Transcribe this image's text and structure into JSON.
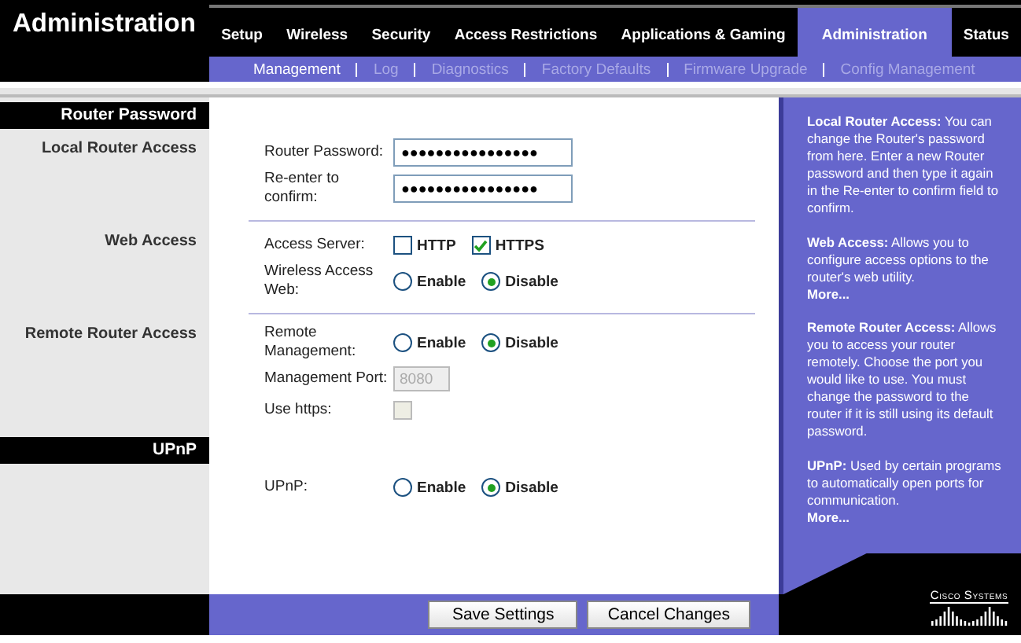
{
  "header": {
    "title": "Administration"
  },
  "tabs": [
    {
      "label": "Setup",
      "selected": false
    },
    {
      "label": "Wireless",
      "selected": false
    },
    {
      "label": "Security",
      "selected": false
    },
    {
      "label": "Access Restrictions",
      "selected": false
    },
    {
      "label": "Applications & Gaming",
      "selected": false
    },
    {
      "label": "Administration",
      "selected": true
    },
    {
      "label": "Status",
      "selected": false
    }
  ],
  "subtabs": [
    {
      "label": "Management",
      "selected": true
    },
    {
      "label": "Log",
      "selected": false
    },
    {
      "label": "Diagnostics",
      "selected": false
    },
    {
      "label": "Factory Defaults",
      "selected": false
    },
    {
      "label": "Firmware Upgrade",
      "selected": false
    },
    {
      "label": "Config Management",
      "selected": false
    }
  ],
  "rows": [
    {
      "kind": "header",
      "label": "Router Password"
    },
    {
      "kind": "section",
      "label": "Local Router Access",
      "fields": [
        {
          "kind": "password",
          "label": "Router Password:",
          "value": "●●●●●●●●●●●●●●●●"
        },
        {
          "kind": "password",
          "label": "Re-enter to confirm:",
          "value": "●●●●●●●●●●●●●●●●"
        }
      ]
    },
    {
      "kind": "section",
      "label": "Web Access",
      "fields": [
        {
          "kind": "checkboxes",
          "label": "Access Server:",
          "options": [
            {
              "label": "HTTP",
              "checked": false
            },
            {
              "label": "HTTPS",
              "checked": true
            }
          ]
        },
        {
          "kind": "radios",
          "label": "Wireless Access Web:",
          "options": [
            {
              "label": "Enable",
              "selected": false
            },
            {
              "label": "Disable",
              "selected": true
            }
          ]
        }
      ]
    },
    {
      "kind": "section",
      "label": "Remote Router Access",
      "fields": [
        {
          "kind": "radios",
          "label": "Remote Management:",
          "options": [
            {
              "label": "Enable",
              "selected": false
            },
            {
              "label": "Disable",
              "selected": true
            }
          ]
        },
        {
          "kind": "text",
          "label": "Management Port:",
          "value": "8080",
          "disabled": true
        },
        {
          "kind": "checkbox",
          "label": "Use https:",
          "checked": false,
          "disabled": true
        }
      ]
    },
    {
      "kind": "header",
      "label": "UPnP"
    },
    {
      "kind": "section",
      "fields": [
        {
          "kind": "radios",
          "label": "UPnP:",
          "options": [
            {
              "label": "Enable",
              "selected": false
            },
            {
              "label": "Disable",
              "selected": true
            }
          ]
        }
      ]
    }
  ],
  "help": [
    {
      "text": "**Local Router Access:** You can change the Router's password from here. Enter a new Router password and then type it again in the Re-enter to confirm field to confirm."
    },
    {
      "text": "**Web Access:** Allows you to configure access options to the router's web utility.",
      "more": "More..."
    },
    {
      "text": "**Remote Router Access:** Allows you to access your router remotely. Choose the port you would like to use. You must change the password to the router if it is still using its default password."
    },
    {
      "text": "**UPnP:** Used by certain programs to automatically open ports for communication.",
      "more": "More..."
    }
  ],
  "logo": "Cisco Systems",
  "buttons": [
    "Save Settings",
    "Cancel Changes"
  ]
}
